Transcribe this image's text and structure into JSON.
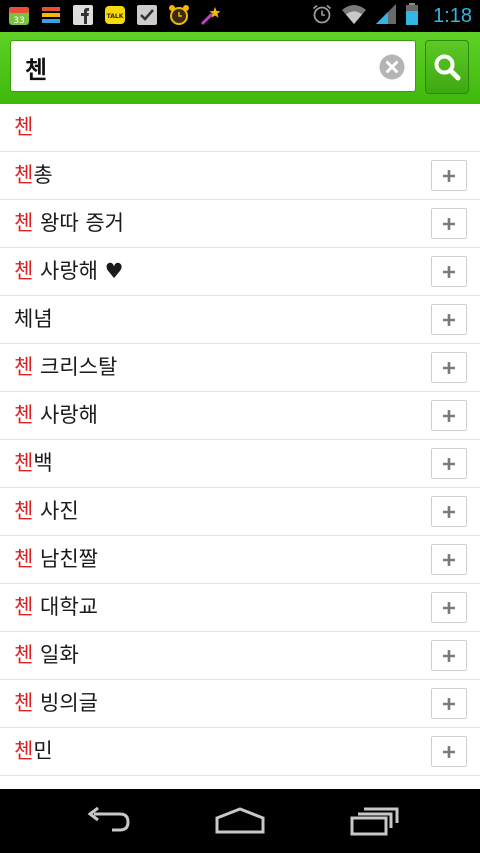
{
  "status_bar": {
    "time": "1:18",
    "notification_icons": [
      "calendar-33-icon",
      "stack-icon",
      "facebook-icon",
      "kakaotalk-icon",
      "checkbox-icon",
      "alarm-clock-icon",
      "shooting-star-icon"
    ],
    "calendar_day": "33",
    "talk_label": "TALK"
  },
  "search": {
    "query": "첸",
    "placeholder": ""
  },
  "suggestions": [
    {
      "highlight": "첸",
      "rest": "",
      "has_add": false
    },
    {
      "highlight": "첸",
      "rest": "총",
      "has_add": true
    },
    {
      "highlight": "첸",
      "rest": " 왕따 증거",
      "has_add": true
    },
    {
      "highlight": "첸",
      "rest": " 사랑해 ♥",
      "has_add": true
    },
    {
      "highlight": "",
      "rest": "체념",
      "has_add": true
    },
    {
      "highlight": "첸",
      "rest": " 크리스탈",
      "has_add": true
    },
    {
      "highlight": "첸",
      "rest": " 사랑해",
      "has_add": true
    },
    {
      "highlight": "첸",
      "rest": "백",
      "has_add": true
    },
    {
      "highlight": "첸",
      "rest": " 사진",
      "has_add": true
    },
    {
      "highlight": "첸",
      "rest": " 남친짤",
      "has_add": true
    },
    {
      "highlight": "첸",
      "rest": " 대학교",
      "has_add": true
    },
    {
      "highlight": "첸",
      "rest": " 일화",
      "has_add": true
    },
    {
      "highlight": "첸",
      "rest": " 빙의글",
      "has_add": true
    },
    {
      "highlight": "첸",
      "rest": "민",
      "has_add": true
    }
  ],
  "add_label": "+",
  "colors": {
    "green": "#46bd12",
    "highlight_red": "#e0201f",
    "time_blue": "#33b5e5"
  }
}
